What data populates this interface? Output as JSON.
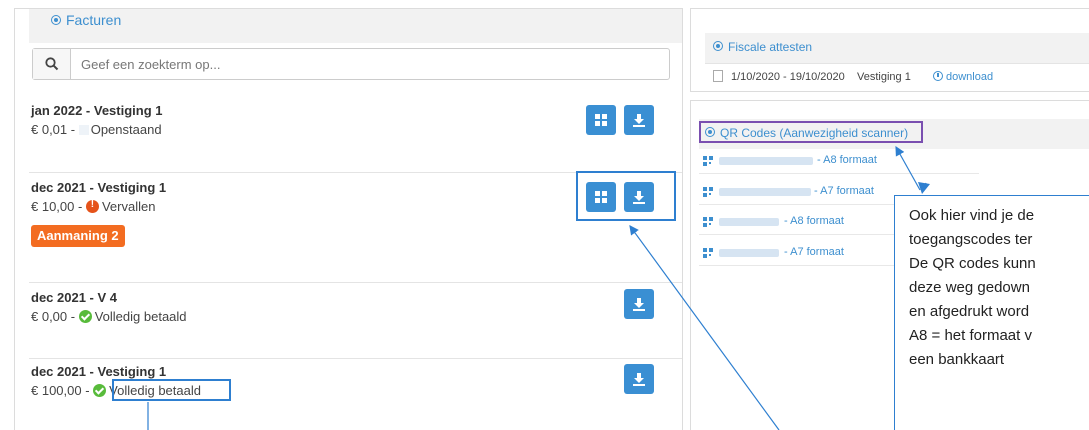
{
  "invoices_panel": {
    "title": "Facturen",
    "search_placeholder": "Geef een zoekterm op...",
    "invoices": [
      {
        "title": "jan 2022 - Vestiging 1",
        "amount": "€ 0,01 -",
        "status": "Openstaand",
        "status_icon": "pending-icon"
      },
      {
        "title": "dec 2021 - Vestiging 1",
        "amount": "€ 10,00 -",
        "status": "Vervallen",
        "status_icon": "warning-icon",
        "badge": "Aanmaning 2"
      },
      {
        "title": "dec 2021 - V 4",
        "amount": "€ 0,00 -",
        "status": "Volledig betaald",
        "status_icon": "check-icon"
      },
      {
        "title": "dec 2021 - Vestiging 1",
        "amount": "€ 100,00 -",
        "status": "Volledig betaald",
        "status_icon": "check-icon"
      }
    ]
  },
  "fiscal_panel": {
    "title": "Fiscale attesten",
    "rows": [
      {
        "period": "1/10/2020 - 19/10/2020",
        "location": "Vestiging 1",
        "action": "download"
      }
    ]
  },
  "qr_panel": {
    "title": "QR Codes (Aanwezigheid scanner)",
    "items": [
      {
        "format": "- A8 formaat"
      },
      {
        "format": "- A7 formaat"
      },
      {
        "format": "- A8 formaat"
      },
      {
        "format": "- A7 formaat"
      }
    ]
  },
  "callout": {
    "lines": [
      "Ook hier vind je de",
      "toegangscodes ter",
      "De QR codes kunn",
      "deze weg gedown",
      "en afgedrukt word",
      "A8 = het formaat v",
      "een bankkaart"
    ]
  },
  "colors": {
    "accent": "#3a8fd3",
    "link": "#3d8fcf",
    "warning_badge": "#f36c21",
    "danger": "#e5531a",
    "success": "#58bb3b",
    "highlight_blue": "#2e7fd0",
    "highlight_purple": "#7a4fb0"
  }
}
